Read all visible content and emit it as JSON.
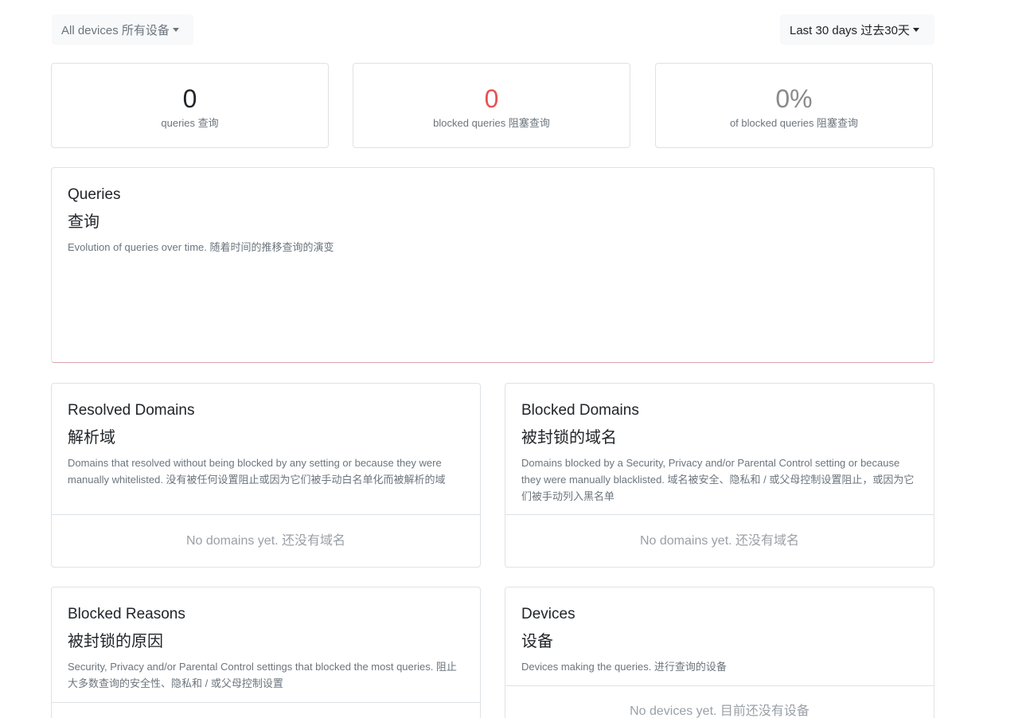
{
  "filters": {
    "devices_label": "All devices 所有设备",
    "range_label": "Last 30 days 过去30天"
  },
  "stats": [
    {
      "value": "0",
      "label": "queries 查询"
    },
    {
      "value": "0",
      "label": "blocked queries 阻塞查询"
    },
    {
      "value": "0%",
      "label": "of blocked queries 阻塞查询"
    }
  ],
  "queries_card": {
    "title": "Queries",
    "title_zh": "查询",
    "description": "Evolution of queries over time. 随着时间的推移查询的演变"
  },
  "resolved_card": {
    "title": "Resolved Domains",
    "title_zh": "解析域",
    "description": "Domains that resolved without being blocked by any setting or because they were manually whitelisted. 没有被任何设置阻止或因为它们被手动白名单化而被解析的域",
    "empty": "No domains yet. 还没有域名"
  },
  "blocked_card": {
    "title": "Blocked Domains",
    "title_zh": "被封锁的域名",
    "description": "Domains blocked by a Security, Privacy and/or Parental Control setting or because they were manually blacklisted. 域名被安全、隐私和 / 或父母控制设置阻止，或因为它们被手动列入黑名单",
    "empty": "No domains yet. 还没有域名"
  },
  "reasons_card": {
    "title": "Blocked Reasons",
    "title_zh": "被封锁的原因",
    "description": "Security, Privacy and/or Parental Control settings that blocked the most queries. 阻止大多数查询的安全性、隐私和 / 或父母控制设置"
  },
  "devices_card": {
    "title": "Devices",
    "title_zh": "设备",
    "description": "Devices making the queries. 进行查询的设备",
    "empty": "No devices yet. 目前还没有设备"
  },
  "colors": {
    "blocked_value": "#e55353",
    "percent_value": "#8a8a8a",
    "border": "#dee2e6"
  }
}
